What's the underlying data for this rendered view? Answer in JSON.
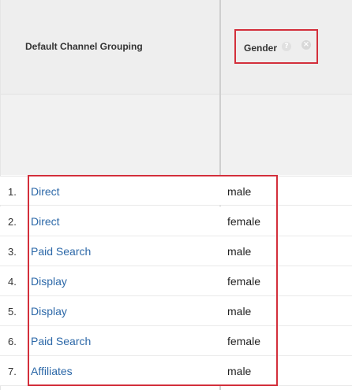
{
  "table": {
    "channel_header": "Default Channel Grouping",
    "gender_header": "Gender",
    "help_icon": "question-mark-icon",
    "close_icon": "close-circle-icon",
    "rows": [
      {
        "index": "1.",
        "channel": "Direct",
        "gender": "male"
      },
      {
        "index": "2.",
        "channel": "Direct",
        "gender": "female"
      },
      {
        "index": "3.",
        "channel": "Paid Search",
        "gender": "male"
      },
      {
        "index": "4.",
        "channel": "Display",
        "gender": "female"
      },
      {
        "index": "5.",
        "channel": "Display",
        "gender": "male"
      },
      {
        "index": "6.",
        "channel": "Paid Search",
        "gender": "female"
      },
      {
        "index": "7.",
        "channel": "Affiliates",
        "gender": "male"
      }
    ]
  },
  "colors": {
    "highlight": "#d32f3b",
    "link": "#2c68a8",
    "header_bg": "#eeeeee"
  }
}
